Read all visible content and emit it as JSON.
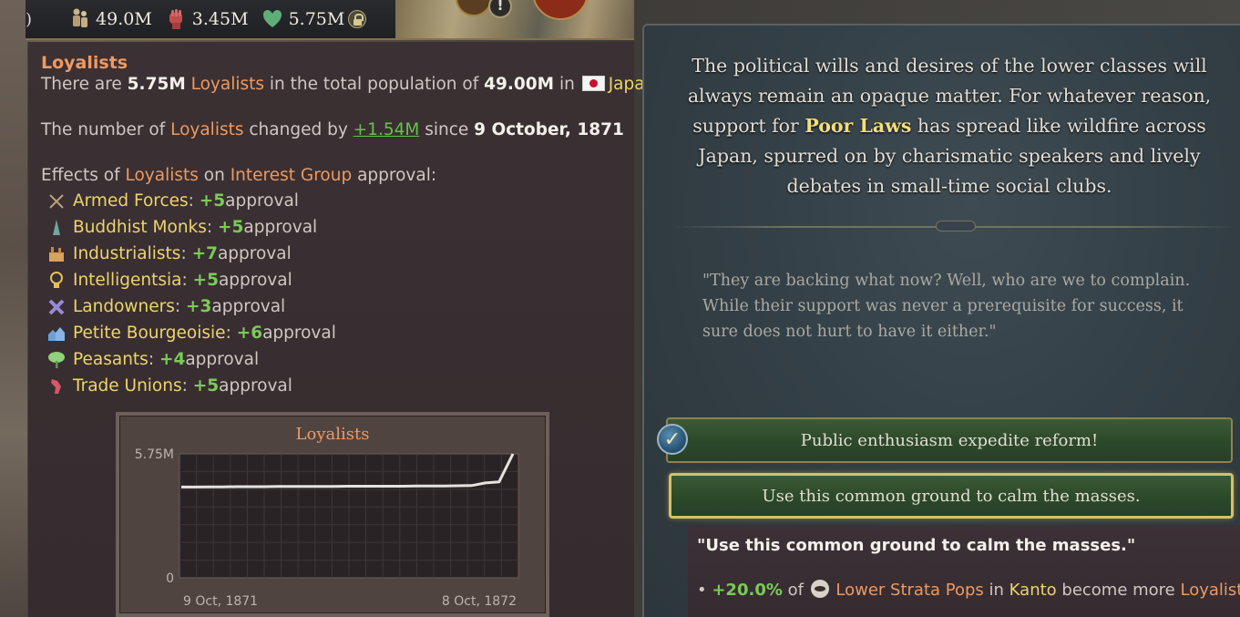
{
  "topbar": {
    "lead_glyph": ")",
    "population": "49.0M",
    "radicals": "3.45M",
    "loyalists": "5.75M"
  },
  "tooltip": {
    "title": "Loyalists",
    "pop_line": {
      "pre": "There are ",
      "count": "5.75M",
      "group": "Loyalists",
      "mid": " in the total population of ",
      "total": "49.00M",
      "in": " in ",
      "country": "Japan"
    },
    "change_line": {
      "pre": "The number of ",
      "group": "Loyalists",
      "mid": " changed by ",
      "delta": "+1.54M",
      "since": " since ",
      "date": "9 October, 1871"
    },
    "effects_line": {
      "pre": "Effects of ",
      "group": "Loyalists",
      "on": " on ",
      "target": "Interest Group",
      "post": " approval:"
    },
    "interest_groups": [
      {
        "name": "Armed Forces",
        "value": "+5",
        "suffix": " approval",
        "icon": "crossed-swords-icon",
        "color": "#b9a27a"
      },
      {
        "name": "Buddhist Monks",
        "value": "+5",
        "suffix": " approval",
        "icon": "temple-icon",
        "color": "#6fa8a0"
      },
      {
        "name": "Industrialists",
        "value": "+7",
        "suffix": " approval",
        "icon": "factory-icon",
        "color": "#d9a35c"
      },
      {
        "name": "Intelligentsia",
        "value": "+5",
        "suffix": " approval",
        "icon": "lightbulb-icon",
        "color": "#e3c05a"
      },
      {
        "name": "Landowners",
        "value": "+3",
        "suffix": " approval",
        "icon": "windmill-icon",
        "color": "#9a8ad6"
      },
      {
        "name": "Petite Bourgeoisie",
        "value": "+6",
        "suffix": " approval",
        "icon": "houses-icon",
        "color": "#6f9fd8"
      },
      {
        "name": "Peasants",
        "value": "+4",
        "suffix": " approval",
        "icon": "tree-icon",
        "color": "#8fd27a"
      },
      {
        "name": "Trade Unions",
        "value": "+5",
        "suffix": " approval",
        "icon": "fist-icon",
        "color": "#d8576b"
      }
    ]
  },
  "chart_data": {
    "type": "line",
    "title": "Loyalists",
    "y_tick_labels": [
      "5.75M",
      "0"
    ],
    "x_tick_labels": [
      "9 Oct, 1871",
      "8 Oct, 1872"
    ],
    "ylim": [
      0,
      5.75
    ],
    "grid": true,
    "series": [
      {
        "values": [
          4.21,
          4.21,
          4.22,
          4.22,
          4.23,
          4.23,
          4.23,
          4.24,
          4.24,
          4.24,
          4.24,
          4.24,
          4.25,
          4.25,
          4.25,
          4.25,
          4.25,
          4.26,
          4.26,
          4.26,
          4.27,
          4.28,
          4.4,
          4.45,
          5.75
        ]
      }
    ]
  },
  "event": {
    "desc_pre": "The political wills and desires of the lower classes will always remain an opaque matter. For whatever reason, support for ",
    "desc_highlight": "Poor Laws",
    "desc_post": " has spread like wildfire across Japan, spurred on by charismatic speakers and lively debates in small-time social clubs.",
    "quote": "\"They are backing what now? Well, who are we to complain. While their support was never a prerequisite for success, it sure does not hurt to have it either.\"",
    "options": [
      {
        "label": "Public enthusiasm expedite reform!"
      },
      {
        "label": "Use this common ground to calm the masses."
      }
    ],
    "effect": {
      "title": "\"Use this common ground to calm the masses.\"",
      "bullet": "• ",
      "pct": "+20.0%",
      "of": " of ",
      "pops": "Lower Strata Pops",
      "in": " in ",
      "region": "Kanto",
      "becomes": " become more ",
      "group": "Loyalist"
    },
    "colors": {
      "accent": "#f2de7a",
      "positive": "#7acb57",
      "group": "#ec9a61"
    }
  }
}
